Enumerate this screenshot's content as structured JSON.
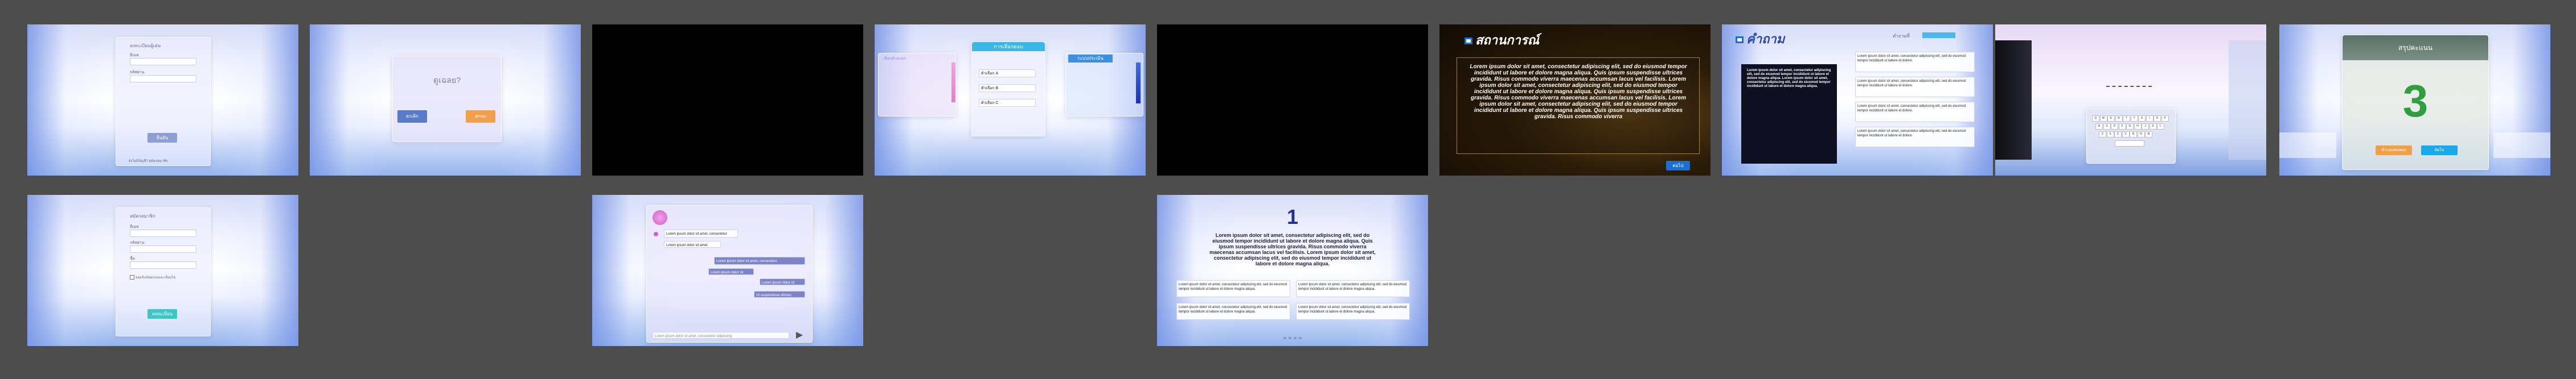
{
  "slides": {
    "login": {
      "title": "ลงทะเบียนผู้เล่น",
      "email_label": "อีเมล",
      "password_label": "รหัสผ่าน",
      "submit": "ยืนยัน",
      "footer": "ยังไม่มีบัญชี? สมัครสมาชิก"
    },
    "dialog": {
      "question": "ดูเฉลย?",
      "no": "ยกเลิก",
      "yes": "ตกลง"
    },
    "choices": {
      "left_header": "เลือกตัวละคร",
      "center_header": "การเลือกตอบ",
      "right_header": "ระบบประเมิน",
      "options": [
        "ตัวเลือก A",
        "ตัวเลือก B",
        "ตัวเลือก C"
      ]
    },
    "situation": {
      "title": "สถานการณ์",
      "body": "Lorem ipsum dolor sit amet, consectetur adipiscing elit, sed do eiusmod tempor incididunt ut labore et dolore magna aliqua. Quis ipsum suspendisse ultrices gravida. Risus commodo viverra maecenas accumsan lacus vel facilisis. Lorem ipsum dolor sit amet, consectetur adipiscing elit, sed do eiusmod tempor incididunt ut labore et dolore magna aliqua. Quis ipsum suspendisse ultrices gravida. Risus commodo viverra maecenas accumsan lacus vel facilisis. Lorem ipsum dolor sit amet, consectetur adipiscing elit, sed do eiusmod tempor incididunt ut labore et dolore magna aliqua. Quis ipsum suspendisse ultrices gravida. Risus commodo viverra",
      "next": "ต่อไป"
    },
    "question": {
      "title": "คำถาม",
      "top_label": "คำถามที่",
      "dark_text": "Lorem ipsum dolor sit amet, consectetur adipiscing elit, sed do eiusmod tempor incididunt ut labore et dolore magna aliqua. Lorem ipsum dolor sit amet, consectetur adipiscing elit, sed do eiusmod tempor incididunt ut labore et dolore magna aliqua.",
      "answer_text": "Lorem ipsum dolor sit amet, consectetur adipiscing elit, sed do eiusmod tempor incididunt ut labore et dolore."
    },
    "keyboard": {
      "keys": [
        "Q",
        "W",
        "E",
        "R",
        "T",
        "Y",
        "U",
        "I",
        "O",
        "P",
        "A",
        "S",
        "D",
        "F",
        "G",
        "H",
        "J",
        "K",
        "L",
        "Z",
        "X",
        "C",
        "V",
        "B",
        "N",
        "M"
      ]
    },
    "summary": {
      "title": "สรุปคะแนน",
      "score": "3",
      "btn_left": "ทำแบบทดสอบ",
      "btn_right": "ถัดไป"
    },
    "register": {
      "title": "สมัครสมาชิก",
      "email_label": "อีเมล",
      "password_label": "รหัสผ่าน",
      "name_label": "ชื่อ",
      "checkbox": "ยอมรับข้อตกลงและเงื่อนไข",
      "submit": "ลงทะเบียน"
    },
    "chat": {
      "msg1": "Lorem ipsum dolor sit amet, consectetur",
      "msg2": "Lorem ipsum dolor sit amet",
      "msg3": "Lorem ipsum dolor sit amet, consectetur",
      "msg4": "Lorem ipsum dolor sit amet",
      "msg5": "Lorem ipsum dolor sit",
      "msg6": "Ut suspendisse ultrices",
      "input_placeholder": "Lorem ipsum dolor sit amet, consectetur adipiscing"
    },
    "numbered": {
      "number": "1",
      "body": "Lorem ipsum dolor sit amet, consectetur adipiscing elit, sed do eiusmod tempor incididunt ut labore et dolore magna aliqua. Quis ipsum suspendisse ultrices gravida. Risus commodo viverra maecenas accumsan lacus vel facilisis. Lorem ipsum dolor sit amet, consectetur adipiscing elit, sed do eiusmod tempor incididunt ut labore et dolore magna aliqua.",
      "card_text": "Lorem ipsum dolor sit amet, consectetur adipiscing elit, sed do eiusmod tempor incididunt ut labore et dolore magna aliqua."
    }
  },
  "colors": {
    "accent_blue": "#1a6fd6",
    "pink": "#e77bd0",
    "orange": "#f0a04b",
    "score_green": "#2f9e3e"
  }
}
